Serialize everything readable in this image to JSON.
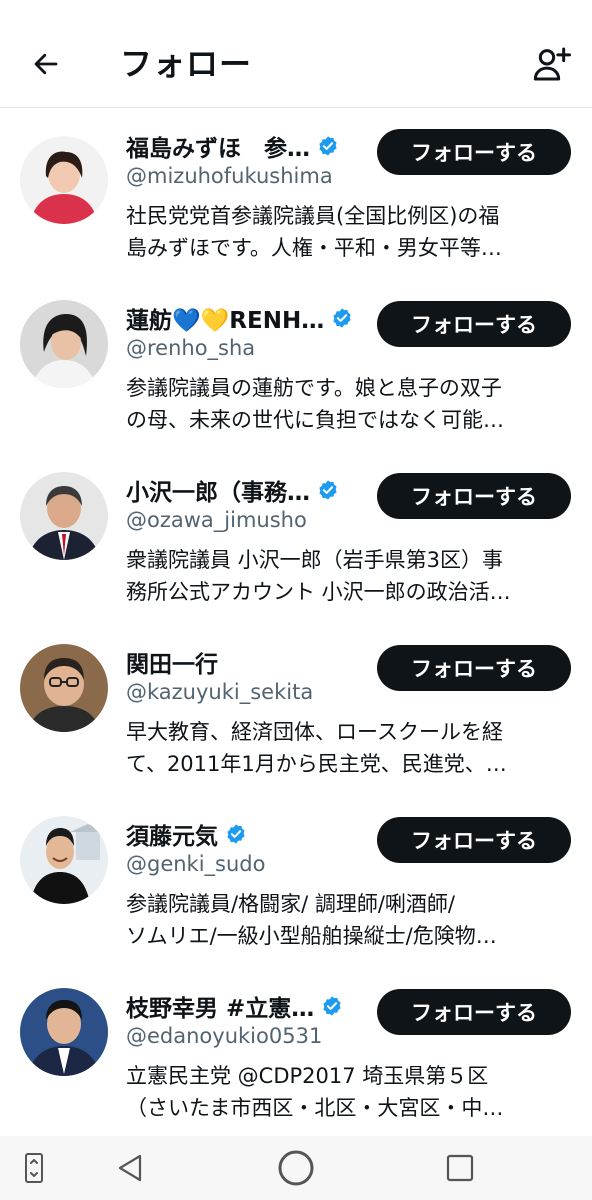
{
  "header": {
    "title": "フォロー"
  },
  "accounts": [
    {
      "name": "福島みずほ　参…",
      "verified": true,
      "handle": "@mizuhofukushima",
      "bio": [
        "社民党党首参議院議員(全国比例区)の福",
        "島みずほです。人権・平和・男女平等…"
      ],
      "follow_label": "フォローする",
      "avatar_colors": {
        "bg": "#f2f2f2",
        "hair": "#2a1c16",
        "skin": "#f0c9b0",
        "clothes": "#d9324a"
      }
    },
    {
      "name": "蓮舫💙💛RENH…",
      "verified": true,
      "handle": "@renho_sha",
      "bio": [
        "参議院議員の蓮舫です。娘と息子の双子",
        "の母、未来の世代に負担ではなく可能…"
      ],
      "follow_label": "フォローする",
      "avatar_colors": {
        "bg": "#d9d9d9",
        "hair": "#1b1b1b",
        "skin": "#e8c1a6",
        "clothes": "#f4f4f4"
      }
    },
    {
      "name": "小沢一郎（事務…",
      "verified": true,
      "handle": "@ozawa_jimusho",
      "bio": [
        "衆議院議員 小沢一郎（岩手県第3区）事",
        "務所公式アカウント 小沢一郎の政治活…"
      ],
      "follow_label": "フォローする",
      "avatar_colors": {
        "bg": "#e6e6e6",
        "hair": "#3a3a3a",
        "skin": "#d9a98a",
        "clothes": "#1d2233"
      }
    },
    {
      "name": "関田一行",
      "verified": false,
      "handle": "@kazuyuki_sekita",
      "bio": [
        "早大教育、経済団体、ロースクールを経",
        "て、2011年1月から民主党、民進党、…"
      ],
      "follow_label": "フォローする",
      "avatar_colors": {
        "bg": "#8a6a4a",
        "hair": "#2a221c",
        "skin": "#e0b393",
        "clothes": "#2b2b2b"
      }
    },
    {
      "name": "須藤元気",
      "verified": true,
      "handle": "@genki_sudo",
      "bio": [
        "参議院議員/格闘家/ 調理師/唎酒師/",
        "ソムリエ/一級小型船舶操縦士/危険物…"
      ],
      "follow_label": "フォローする",
      "avatar_colors": {
        "bg": "#e9eef2",
        "hair": "#1a1a1a",
        "skin": "#e3b896",
        "clothes": "#111111"
      }
    },
    {
      "name": "枝野幸男 #立憲…",
      "verified": true,
      "handle": "@edanoyukio0531",
      "bio": [
        "立憲民主党 @CDP2017 埼玉県第５区",
        "（さいたま市西区・北区・大宮区・中…"
      ],
      "follow_label": "フォローする",
      "avatar_colors": {
        "bg": "#2b4f86",
        "hair": "#141414",
        "skin": "#e2b596",
        "clothes": "#1c2744"
      }
    }
  ],
  "colors": {
    "verified": "#1d9bf0",
    "button_bg": "#0f1419",
    "handle": "#536471"
  },
  "icons": {
    "back": "back-arrow-icon",
    "add_user": "add-user-icon",
    "verified": "verified-badge-icon",
    "nav": [
      "recent-apps-icon",
      "back-triangle-icon",
      "home-circle-icon",
      "overview-square-icon"
    ]
  }
}
